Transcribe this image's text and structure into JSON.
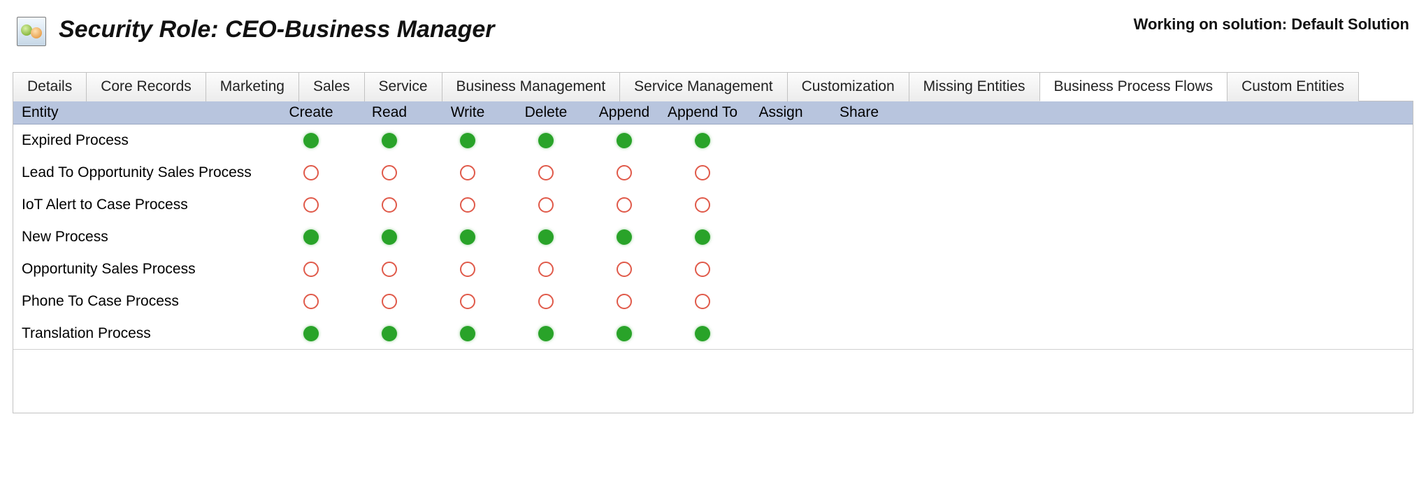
{
  "header": {
    "title": "Security Role: CEO-Business Manager",
    "solution_label": "Working on solution: Default Solution"
  },
  "tabs": [
    "Details",
    "Core Records",
    "Marketing",
    "Sales",
    "Service",
    "Business Management",
    "Service Management",
    "Customization",
    "Missing Entities",
    "Business Process Flows",
    "Custom Entities"
  ],
  "active_tab": "Business Process Flows",
  "columns": {
    "entity": "Entity",
    "privs": [
      "Create",
      "Read",
      "Write",
      "Delete",
      "Append",
      "Append To",
      "Assign",
      "Share"
    ]
  },
  "rows": [
    {
      "entity": "Expired Process",
      "priv": [
        "full",
        "full",
        "full",
        "full",
        "full",
        "full",
        "",
        ""
      ]
    },
    {
      "entity": "Lead To Opportunity Sales Process",
      "priv": [
        "none",
        "none",
        "none",
        "none",
        "none",
        "none",
        "",
        ""
      ]
    },
    {
      "entity": "IoT Alert to Case Process",
      "priv": [
        "none",
        "none",
        "none",
        "none",
        "none",
        "none",
        "",
        ""
      ]
    },
    {
      "entity": "New Process",
      "priv": [
        "full",
        "full",
        "full",
        "full",
        "full",
        "full",
        "",
        ""
      ]
    },
    {
      "entity": "Opportunity Sales Process",
      "priv": [
        "none",
        "none",
        "none",
        "none",
        "none",
        "none",
        "",
        ""
      ]
    },
    {
      "entity": "Phone To Case Process",
      "priv": [
        "none",
        "none",
        "none",
        "none",
        "none",
        "none",
        "",
        ""
      ]
    },
    {
      "entity": "Translation Process",
      "priv": [
        "full",
        "full",
        "full",
        "full",
        "full",
        "full",
        "",
        ""
      ]
    }
  ]
}
